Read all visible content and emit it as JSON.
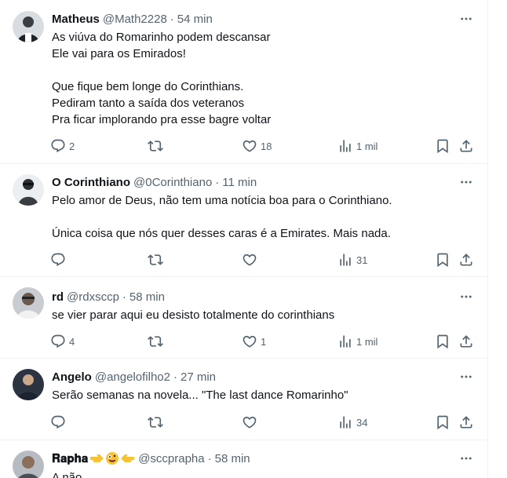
{
  "colors": {
    "text": "#0f1419",
    "muted": "#536471",
    "border": "#eff3f4"
  },
  "tweets": [
    {
      "name": "Matheus",
      "handle": "@Math2228",
      "dot": "·",
      "time": "54 min",
      "text": [
        "As viúva do Romarinho podem descansar",
        "Ele vai para os Emirados!",
        "",
        "Que fique bem longe do Corinthians.",
        "Pediram tanto a saída dos veteranos",
        "Pra ficar implorando pra esse bagre voltar"
      ],
      "replies": "2",
      "retweets": "",
      "likes": "18",
      "views": "1 mil"
    },
    {
      "name": "O Corinthiano",
      "handle": "@0Corinthiano",
      "dot": "·",
      "time": "11 min",
      "text": [
        "Pelo amor de Deus, não tem uma notícia boa para o Corinthiano.",
        "",
        "Única coisa que nós quer desses caras é a Emirates. Mais nada."
      ],
      "replies": "",
      "retweets": "",
      "likes": "",
      "views": "31"
    },
    {
      "name": "rd",
      "handle": "@rdxsccp",
      "dot": "·",
      "time": "58 min",
      "text": [
        "se vier parar aqui eu desisto totalmente do corinthians"
      ],
      "replies": "4",
      "retweets": "",
      "likes": "1",
      "views": "1 mil"
    },
    {
      "name": "Angelo",
      "handle": "@angelofilho2",
      "dot": "·",
      "time": "27 min",
      "text": [
        "Serão semanas na novela... \"The last dance Romarinho\""
      ],
      "replies": "",
      "retweets": "",
      "likes": "",
      "views": "34"
    },
    {
      "name": "𝐑𝐚𝐩𝐡𝐚",
      "handle": "@sccprapha",
      "dot": "·",
      "time": "58 min",
      "text": [
        "A não"
      ],
      "replies": "",
      "retweets": "",
      "likes": "",
      "views": ""
    }
  ]
}
